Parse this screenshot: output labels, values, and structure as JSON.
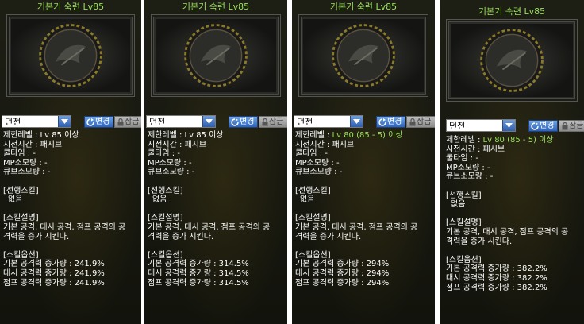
{
  "panels": [
    {
      "title": "기본기 숙련 Lv85",
      "dropdown_value": "던전",
      "change_button": "변경",
      "lock_button": "잠금",
      "level_label": "제한레벨 : ",
      "level_value": "Lv 85 이상",
      "level_highlight": false,
      "cast_time": "시전시간 : 패시브",
      "cooldown": "쿨타임 : -",
      "mp_cost": "MP소모량 : -",
      "cube_cost": "큐브소모량 : -",
      "prereq_header": "[선행스킬]",
      "prereq_value": "없음",
      "desc_header": "[스킬설명]",
      "desc_line1": "기본 공격, 대시 공격, 점프 공격의 공",
      "desc_line2": "격력을 증가 시킨다.",
      "option_header": "[스킬옵션]",
      "option_lines": [
        "기본 공격력 증가량 : 241.9%",
        "대시 공격력 증가량 : 241.9%",
        "점프 공격력 증가량 : 241.9%"
      ]
    },
    {
      "title": "기본기 숙련 Lv85",
      "dropdown_value": "던전",
      "change_button": "변경",
      "lock_button": "잠금",
      "level_label": "제한레벨 : ",
      "level_value": "Lv 85 이상",
      "level_highlight": false,
      "cast_time": "시전시간 : 패시브",
      "cooldown": "쿨타임 : -",
      "mp_cost": "MP소모량 : -",
      "cube_cost": "큐브소모량 : -",
      "prereq_header": "[선행스킬]",
      "prereq_value": "없음",
      "desc_header": "[스킬설명]",
      "desc_line1": "기본 공격, 대시 공격, 점프 공격의 공",
      "desc_line2": "격력을 증가 시킨다.",
      "option_header": "[스킬옵션]",
      "option_lines": [
        "기본 공격력 증가량 : 314.5%",
        "대시 공격력 증가량 : 314.5%",
        "점프 공격력 증가량 : 314.5%"
      ]
    },
    {
      "title": "기본기 숙련 Lv85",
      "dropdown_value": "던전",
      "change_button": "변경",
      "lock_button": "잠금",
      "level_label": "제한레벨 : ",
      "level_value": "Lv 80 (85 - 5) 이상",
      "level_highlight": true,
      "cast_time": "시전시간 : 패시브",
      "cooldown": "쿨타임 : -",
      "mp_cost": "MP소모량 : -",
      "cube_cost": "큐브소모량 : -",
      "prereq_header": "[선행스킬]",
      "prereq_value": "없음",
      "desc_header": "[스킬설명]",
      "desc_line1": "기본 공격, 대시 공격, 점프 공격의 공",
      "desc_line2": "격력을 증가 시킨다.",
      "option_header": "[스킬옵션]",
      "option_lines": [
        "기본 공격력 증가량 : 294%",
        "대시 공격력 증가량 : 294%",
        "점프 공격력 증가량 : 294%"
      ]
    },
    {
      "title": "기본기 숙련 Lv85",
      "dropdown_value": "던전",
      "change_button": "변경",
      "lock_button": "잠금",
      "level_label": "제한레벨 : ",
      "level_value": "Lv 80 (85 - 5) 이상",
      "level_highlight": true,
      "cast_time": "시전시간 : 패시브",
      "cooldown": "쿨타임 : -",
      "mp_cost": "MP소모량 : -",
      "cube_cost": "큐브소모량 : -",
      "prereq_header": "[선행스킬]",
      "prereq_value": "없음",
      "desc_header": "[스킬설명]",
      "desc_line1": "기본 공격, 대시 공격, 점프 공격의 공",
      "desc_line2": "격력을 증가 시킨다.",
      "option_header": "[스킬옵션]",
      "option_lines": [
        "기본 공격력 증가량 : 382.2%",
        "대시 공격력 증가량 : 382.2%",
        "점프 공격력 증가량 : 382.2%"
      ]
    }
  ],
  "colors": {
    "title_green": "#9be05a",
    "text_white": "#ffffff",
    "panel_bg": "#16170f",
    "button_blue": "#2e63b8",
    "button_gray": "#8d8d8d"
  },
  "icons": [
    "skill-emblem-icon",
    "dropdown-arrow-icon",
    "refresh-icon",
    "lock-icon"
  ]
}
